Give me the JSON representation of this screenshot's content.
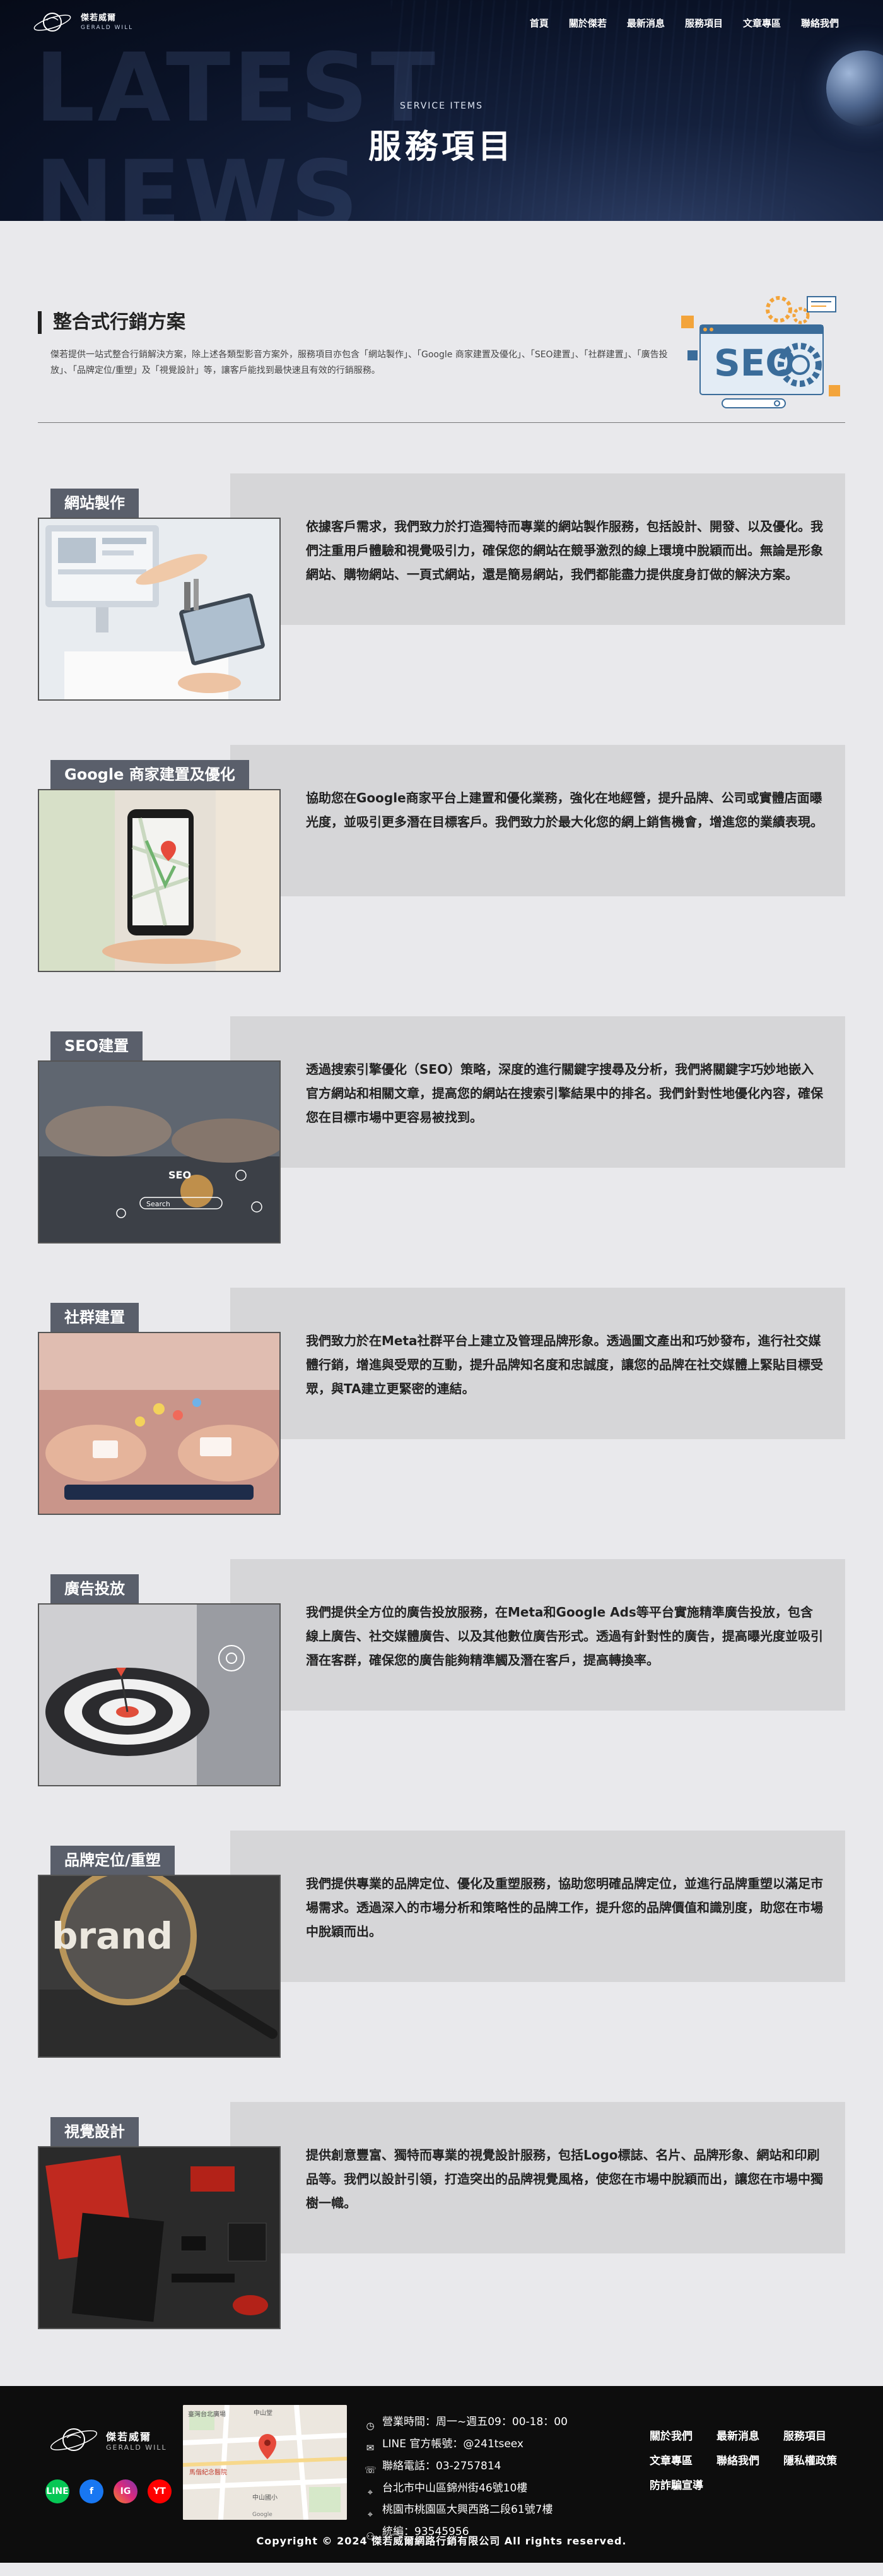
{
  "brand": {
    "name": "傑若威爾",
    "name_en": "GERALD WILL"
  },
  "nav": {
    "items": [
      "首頁",
      "關於傑若",
      "最新消息",
      "服務項目",
      "文章專區",
      "聯絡我們"
    ]
  },
  "hero": {
    "bg_word_1": "LATEST",
    "bg_word_2": "NEWS",
    "subtitle": "SERVICE ITEMS",
    "title": "服務項目"
  },
  "intro": {
    "title": "整合式行銷方案",
    "description": "傑若提供一站式整合行銷解決方案，除上述各類型影音方案外，服務項目亦包含「網站製作」、「Google 商家建置及優化」、「SEO建置」、「社群建置」、「廣告投放」、「品牌定位/重塑」及「視覺設計」等，讓客戶能找到最快速且有效的行銷服務。",
    "illustration_text": "SEO"
  },
  "services": [
    {
      "tag": "網站製作",
      "text": "依據客戶需求，我們致力於打造獨特而專業的網站製作服務，包括設計、開發、以及優化。我們注重用戶體驗和視覺吸引力，確保您的網站在競爭激烈的線上環境中脫穎而出。無論是形象網站、購物網站、一頁式網站，還是簡易網站，我們都能盡力提供度身訂做的解決方案。"
    },
    {
      "tag": "Google 商家建置及優化",
      "text": "協助您在Google商家平台上建置和優化業務，強化在地經營，提升品牌、公司或實體店面曝光度，並吸引更多潛在目標客戶。我們致力於最大化您的網上銷售機會，增進您的業績表現。"
    },
    {
      "tag": "SEO建置",
      "text": "透過搜索引擎優化（SEO）策略，深度的進行關鍵字搜尋及分析，我們將關鍵字巧妙地嵌入官方網站和相關文章，提高您的網站在搜索引擎結果中的排名。我們針對性地優化內容，確保您在目標市場中更容易被找到。"
    },
    {
      "tag": "社群建置",
      "text": "我們致力於在Meta社群平台上建立及管理品牌形象。透過圖文產出和巧妙發布，進行社交媒體行銷，增進與受眾的互動，提升品牌知名度和忠誠度，讓您的品牌在社交媒體上緊貼目標受眾，與TA建立更緊密的連結。"
    },
    {
      "tag": "廣告投放",
      "text": "我們提供全方位的廣告投放服務，在Meta和Google Ads等平台實施精準廣告投放，包含線上廣告、社交媒體廣告、以及其他數位廣告形式。透過有針對性的廣告，提高曝光度並吸引潛在客群，確保您的廣告能夠精準觸及潛在客戶，提高轉換率。"
    },
    {
      "tag": "品牌定位/重塑",
      "text": "我們提供專業的品牌定位、優化及重塑服務，協助您明確品牌定位，並進行品牌重塑以滿足市場需求。透過深入的市場分析和策略性的品牌工作，提升您的品牌價值和識別度，助您在市場中脫穎而出。"
    },
    {
      "tag": "視覺設計",
      "text": "提供創意豐富、獨特而專業的視覺設計服務，包括Logo標誌、名片、品牌形象、網站和印刷品等。我們以設計引領，打造突出的品牌視覺風格，使您在市場中脫穎而出，讓您在市場中獨樹一幟。"
    }
  ],
  "photo_labels": {
    "seo_word": "SEO",
    "search_word": "Search",
    "brand_word": "brand"
  },
  "footer": {
    "map_labels": [
      "中山堂",
      "臺灣台北廣場",
      "馬偕紀念醫院",
      "中山國小",
      "Google"
    ],
    "contact": [
      {
        "icon": "clock-icon",
        "text": "營業時間：周一~週五09：00-18：00"
      },
      {
        "icon": "mail-icon",
        "text": "LINE 官方帳號：@241tseex"
      },
      {
        "icon": "phone-icon",
        "text": "聯絡電話：03-2757814"
      },
      {
        "icon": "location-icon",
        "text": "台北市中山區錦州街46號10樓"
      },
      {
        "icon": "location-icon",
        "text": "桃園市桃園區大興西路二段61號7樓"
      },
      {
        "icon": "user-icon",
        "text": "統編：93545956"
      }
    ],
    "links": [
      "關於我們",
      "最新消息",
      "服務項目",
      "文章專區",
      "聯絡我們",
      "隱私權政策",
      "防詐騙宣導"
    ],
    "social": [
      "LINE",
      "f",
      "IG",
      "YT"
    ],
    "copyright": "Copyright © 2024 傑若威爾網路行銷有限公司 All rights reserved."
  },
  "colors": {
    "tag_bg": "#5a5f6b",
    "panel_bg": "#d6d6d8",
    "page_bg": "#e9e9ec",
    "footer_bg": "#0d0d0d"
  }
}
